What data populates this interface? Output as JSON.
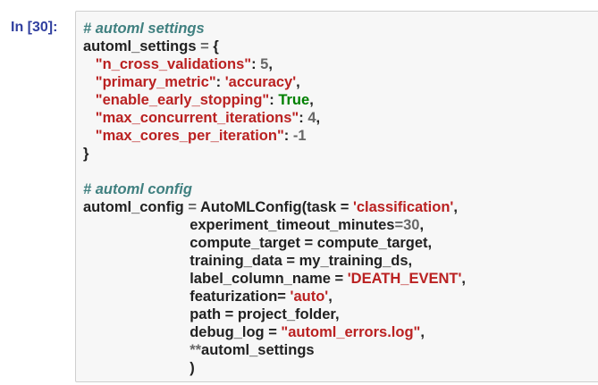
{
  "prompt": "In [30]:",
  "code": {
    "comment1": "# automl settings",
    "var1": "automl_settings",
    "assign": " = ",
    "open_brace": "{",
    "close_brace": "}",
    "settings": [
      {
        "indent": "   ",
        "key": "\"n_cross_validations\"",
        "sep": ": ",
        "value": "5",
        "value_type": "number",
        "trail": ","
      },
      {
        "indent": "   ",
        "key": "\"primary_metric\"",
        "sep": ": ",
        "value": "'accuracy'",
        "value_type": "string",
        "trail": ","
      },
      {
        "indent": "   ",
        "key": "\"enable_early_stopping\"",
        "sep": ": ",
        "value": "True",
        "value_type": "keyword",
        "trail": ","
      },
      {
        "indent": "   ",
        "key": "\"max_concurrent_iterations\"",
        "sep": ": ",
        "value": "4",
        "value_type": "number",
        "trail": ","
      },
      {
        "indent": "   ",
        "key": "\"max_cores_per_iteration\"",
        "sep": ": ",
        "value": "-1",
        "value_type": "number",
        "trail": ""
      }
    ],
    "comment2": "# automl config",
    "var2": "automl_config",
    "call": "AutoMLConfig(",
    "task_param": "task = ",
    "task_value": "'classification'",
    "comma": ",",
    "indent2": "                          ",
    "timeout_param": "experiment_timeout_minutes",
    "timeout_eq": "=",
    "timeout_value": "30",
    "compute_line": "compute_target = compute_target,",
    "training_line": "training_data = my_training_ds,",
    "label_param": "label_column_name = ",
    "label_value": "'DEATH_EVENT'",
    "feat_param": "featurization= ",
    "feat_value": "'auto'",
    "path_line": "path = project_folder,",
    "debug_param": "debug_log = ",
    "debug_value": "\"automl_errors.log\"",
    "kwargs_op": "**",
    "kwargs_name": "automl_settings",
    "close_paren": ")"
  },
  "colors": {
    "prompt": "#303f9f",
    "comment": "#408080",
    "string": "#ba2121",
    "keyword": "#008000",
    "number": "#666666",
    "text": "#212121",
    "background": "#f7f7f7",
    "border": "#cfcfcf"
  }
}
